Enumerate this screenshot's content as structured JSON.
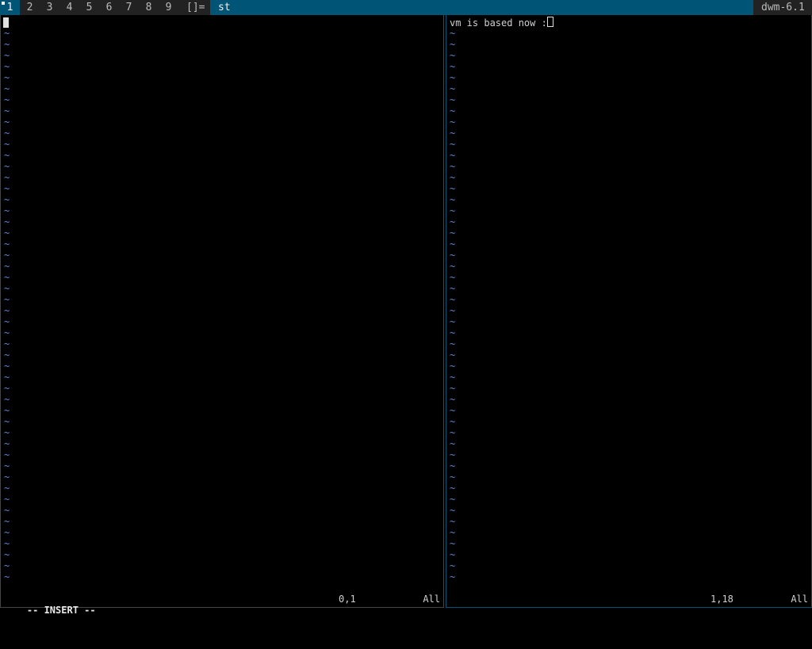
{
  "bar": {
    "tags": [
      "1",
      "2",
      "3",
      "4",
      "5",
      "6",
      "7",
      "8",
      "9"
    ],
    "selected_tag": "1",
    "layout_symbol": "[]=",
    "window_title": "st",
    "status_text": "dwm-6.1",
    "colors": {
      "selected_bg": "#005577",
      "normal_bg": "#222222",
      "normal_fg": "#bbbbbb",
      "selected_fg": "#eeeeee"
    }
  },
  "left_pane": {
    "tilde": "~",
    "mode": "-- INSERT --",
    "position": "0,1",
    "scroll": "All"
  },
  "right_pane": {
    "buffer_text": "vm is based now :",
    "tilde": "~",
    "position": "1,18",
    "scroll": "All"
  }
}
